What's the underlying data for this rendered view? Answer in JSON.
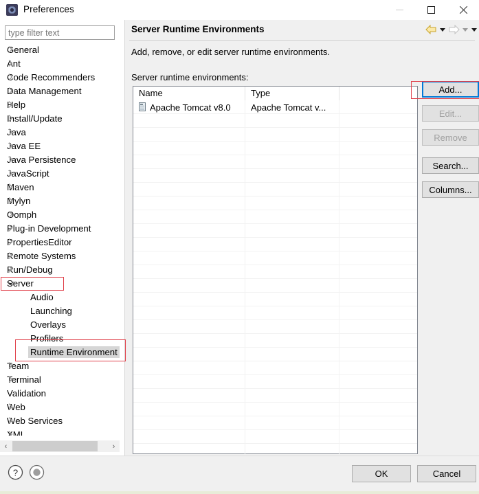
{
  "window": {
    "title": "Preferences",
    "app_icon": "preferences-gear-icon",
    "minimize_label": "—",
    "maximize_label": "□",
    "close_label": "✕"
  },
  "sidebar": {
    "filter": {
      "placeholder": "type filter text",
      "value": ""
    },
    "items": [
      {
        "label": "General",
        "depth": 0,
        "expandable": true,
        "expanded": false,
        "selected": false
      },
      {
        "label": "Ant",
        "depth": 0,
        "expandable": true,
        "expanded": false,
        "selected": false
      },
      {
        "label": "Code Recommenders",
        "depth": 0,
        "expandable": true,
        "expanded": false,
        "selected": false
      },
      {
        "label": "Data Management",
        "depth": 0,
        "expandable": true,
        "expanded": false,
        "selected": false
      },
      {
        "label": "Help",
        "depth": 0,
        "expandable": true,
        "expanded": false,
        "selected": false
      },
      {
        "label": "Install/Update",
        "depth": 0,
        "expandable": true,
        "expanded": false,
        "selected": false
      },
      {
        "label": "Java",
        "depth": 0,
        "expandable": true,
        "expanded": false,
        "selected": false
      },
      {
        "label": "Java EE",
        "depth": 0,
        "expandable": true,
        "expanded": false,
        "selected": false
      },
      {
        "label": "Java Persistence",
        "depth": 0,
        "expandable": true,
        "expanded": false,
        "selected": false
      },
      {
        "label": "JavaScript",
        "depth": 0,
        "expandable": true,
        "expanded": false,
        "selected": false
      },
      {
        "label": "Maven",
        "depth": 0,
        "expandable": true,
        "expanded": false,
        "selected": false
      },
      {
        "label": "Mylyn",
        "depth": 0,
        "expandable": true,
        "expanded": false,
        "selected": false
      },
      {
        "label": "Oomph",
        "depth": 0,
        "expandable": true,
        "expanded": false,
        "selected": false
      },
      {
        "label": "Plug-in Development",
        "depth": 0,
        "expandable": true,
        "expanded": false,
        "selected": false
      },
      {
        "label": "PropertiesEditor",
        "depth": 0,
        "expandable": true,
        "expanded": false,
        "selected": false
      },
      {
        "label": "Remote Systems",
        "depth": 0,
        "expandable": true,
        "expanded": false,
        "selected": false
      },
      {
        "label": "Run/Debug",
        "depth": 0,
        "expandable": true,
        "expanded": false,
        "selected": false
      },
      {
        "label": "Server",
        "depth": 0,
        "expandable": true,
        "expanded": true,
        "selected": false
      },
      {
        "label": "Audio",
        "depth": 1,
        "expandable": false,
        "expanded": false,
        "selected": false
      },
      {
        "label": "Launching",
        "depth": 1,
        "expandable": false,
        "expanded": false,
        "selected": false
      },
      {
        "label": "Overlays",
        "depth": 1,
        "expandable": false,
        "expanded": false,
        "selected": false
      },
      {
        "label": "Profilers",
        "depth": 1,
        "expandable": false,
        "expanded": false,
        "selected": false
      },
      {
        "label": "Runtime Environment",
        "depth": 1,
        "expandable": false,
        "expanded": false,
        "selected": true
      },
      {
        "label": "Team",
        "depth": 0,
        "expandable": true,
        "expanded": false,
        "selected": false
      },
      {
        "label": "Terminal",
        "depth": 0,
        "expandable": true,
        "expanded": false,
        "selected": false
      },
      {
        "label": "Validation",
        "depth": 0,
        "expandable": false,
        "expanded": false,
        "selected": false
      },
      {
        "label": "Web",
        "depth": 0,
        "expandable": true,
        "expanded": false,
        "selected": false
      },
      {
        "label": "Web Services",
        "depth": 0,
        "expandable": true,
        "expanded": false,
        "selected": false
      },
      {
        "label": "XML",
        "depth": 0,
        "expandable": true,
        "expanded": false,
        "selected": false
      }
    ],
    "hscroll": {
      "left_arrow": "‹",
      "right_arrow": "›"
    }
  },
  "panel": {
    "title": "Server Runtime Environments",
    "description": "Add, remove, or edit server runtime environments.",
    "list_label": "Server runtime environments:",
    "nav": {
      "back_icon": "back-arrow-icon",
      "back_caret_icon": "chevron-down-icon",
      "forward_icon": "forward-arrow-icon",
      "forward_caret_icon": "chevron-down-icon",
      "menu_caret_icon": "chevron-down-icon"
    },
    "table": {
      "columns": [
        "Name",
        "Type",
        ""
      ],
      "rows": [
        {
          "icon": "server-icon",
          "name": "Apache Tomcat v8.0",
          "type": "Apache Tomcat v...",
          "extra": ""
        }
      ],
      "empty_row_count": 25
    },
    "buttons": [
      {
        "label": "Add...",
        "enabled": true,
        "focused": true
      },
      {
        "label": "Edit...",
        "enabled": false,
        "focused": false
      },
      {
        "label": "Remove",
        "enabled": false,
        "focused": false
      },
      {
        "label": "Search...",
        "enabled": true,
        "focused": false
      },
      {
        "label": "Columns...",
        "enabled": true,
        "focused": false
      }
    ]
  },
  "footer": {
    "help_icon": "question-mark-help-icon",
    "record_icon": "record-circle-icon",
    "ok_label": "OK",
    "cancel_label": "Cancel"
  },
  "annotations": {
    "accent_color": "#e0404a",
    "focus_color": "#0078d7",
    "boxes": [
      "server-tree-item",
      "runtime-environment-tree-item",
      "add-button"
    ]
  }
}
